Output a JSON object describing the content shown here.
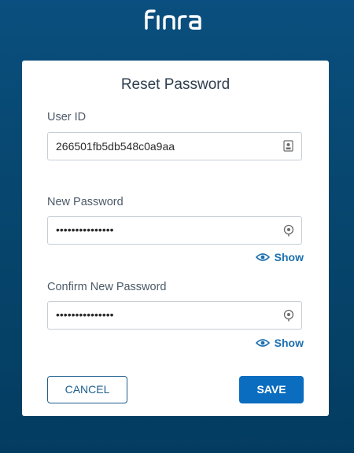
{
  "brand": {
    "logo_text": "FINRA"
  },
  "form": {
    "title": "Reset Password",
    "user_id": {
      "label": "User ID",
      "value": "266501fb5db548c0a9aa"
    },
    "new_password": {
      "label": "New Password",
      "value": "•••••••••••••••",
      "show_label": "Show"
    },
    "confirm_password": {
      "label": "Confirm New Password",
      "value": "•••••••••••••••",
      "show_label": "Show"
    },
    "cancel_label": "CANCEL",
    "save_label": "SAVE"
  },
  "colors": {
    "background": "#07476f",
    "accent": "#0a6dbf",
    "link": "#1a6fb0"
  },
  "icons": {
    "user_id_field": "id-card-icon",
    "password_field": "password-key-icon",
    "show": "eye-icon"
  }
}
